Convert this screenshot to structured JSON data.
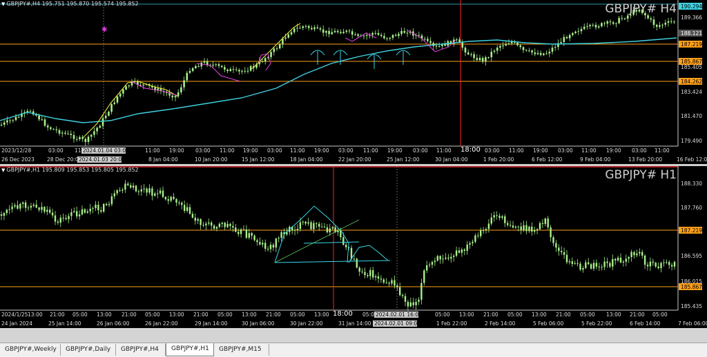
{
  "top": {
    "header": "GBPJPY#,H4  195.751 195.870 195.574 195.852",
    "title": "GBPJPY# H4",
    "price_labels": [
      {
        "text": "190.294",
        "kind": "box-cyan"
      },
      {
        "text": "189.366",
        "kind": "tick"
      },
      {
        "text": "188.121",
        "kind": "box-gray"
      },
      {
        "text": "187.219",
        "kind": "box-orange"
      },
      {
        "text": "185.867",
        "kind": "box-orange"
      },
      {
        "text": "185.405",
        "kind": "tick"
      },
      {
        "text": "184.262",
        "kind": "box-orange"
      },
      {
        "text": "183.424",
        "kind": "tick"
      },
      {
        "text": "181.470",
        "kind": "tick"
      },
      {
        "text": "179.490",
        "kind": "tick"
      }
    ],
    "hour_row": [
      "2023/12/28",
      "03:00",
      "11:00",
      "2024.01.04 03:00",
      "11:00",
      "19:00",
      "03:00",
      "11:00",
      "19:00",
      "03:00",
      "11:00",
      "19:00",
      "03:00",
      "11:00",
      "19:00",
      "03:00",
      "11:00",
      "18:00",
      "03:00",
      "11:00",
      "19:00",
      "03:00",
      "11:00",
      "19:00",
      "03:00",
      "11:00"
    ],
    "date_row": [
      "26 Dec 2023",
      "28 Dec 20:00",
      "2024.01.03 20:00",
      "8 Jan 04:00",
      "10 Jan 20:00",
      "15 Jan 12:00",
      "18 Jan 04:00",
      "22 Jan 20:00",
      "25 Jan 12:00",
      "30 Jan 04:00",
      "1 Feb 20:00",
      "6 Feb 12:00",
      "9 Feb 04:00",
      "13 Feb 20:00",
      "16 Feb 12:00"
    ]
  },
  "bottom": {
    "header": "GBPJPY#,H1  195.809 195.853 195.805 195.852",
    "title": "GBPJPY# H1",
    "price_labels": [
      {
        "text": "188.330",
        "kind": "tick"
      },
      {
        "text": "187.760",
        "kind": "tick"
      },
      {
        "text": "187.219",
        "kind": "box-orange"
      },
      {
        "text": "186.595",
        "kind": "tick"
      },
      {
        "text": "186.015",
        "kind": "tick"
      },
      {
        "text": "185.867",
        "kind": "box-orange"
      },
      {
        "text": "185.435",
        "kind": "tick"
      }
    ],
    "hour_row": [
      "2024/1/25",
      "13:00",
      "21:00",
      "05:00",
      "13:00",
      "21:00",
      "05:00",
      "13:00",
      "21:00",
      "05:00",
      "13:00",
      "21:00",
      "05:00",
      "13:00",
      "18:00",
      "05:00",
      "2024.02.01 16:00",
      "05:00",
      "13:00",
      "21:00",
      "05:00",
      "13:00",
      "21:00",
      "05:00",
      "13:00",
      "21:00",
      "05:00"
    ],
    "date_row": [
      "24 Jan 2024",
      "25 Jan 14:00",
      "26 Jan 06:00",
      "26 Jan 22:00",
      "29 Jan 14:00",
      "30 Jan 06:00",
      "30 Jan 22:00",
      "31 Jan 14:00",
      "2024.02.01 09:00",
      "1 Feb 22:00",
      "2 Feb 14:00",
      "5 Feb 06:00",
      "5 Feb 22:00",
      "6 Feb 14:00",
      "7 Feb 06:00"
    ]
  },
  "tabs": [
    "GBPJPY#,Weekly",
    "GBPJPY#,Daily",
    "GBPJPY#,H4",
    "GBPJPY#,H1",
    "GBPJPY#,M15"
  ],
  "active_tab": "GBPJPY#,H1",
  "colors": {
    "bg": "#000000",
    "candle": "#a8f08a",
    "ma": "#3ed2e0",
    "level": "#ff9f1a",
    "cursor": "#ff2020",
    "pattern_yellow": "#e8e838",
    "pattern_magenta": "#e040e0",
    "drawing_cyan": "#38d8e8"
  }
}
